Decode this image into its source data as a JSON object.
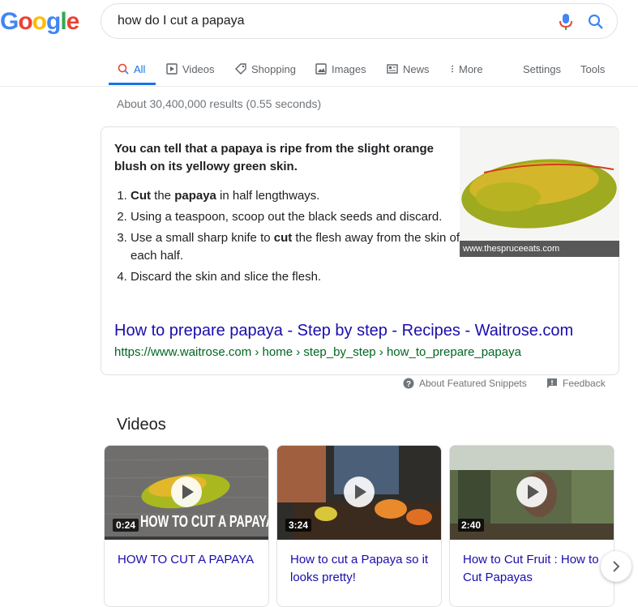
{
  "logo": [
    "G",
    "o",
    "o",
    "g",
    "l",
    "e"
  ],
  "logo_colors": [
    "#4285f4",
    "#ea4335",
    "#fbbc05",
    "#4285f4",
    "#34a853",
    "#ea4335"
  ],
  "search": {
    "query": "how do I cut a papaya"
  },
  "tabs": [
    {
      "label": "All",
      "icon": "search-icon"
    },
    {
      "label": "Videos",
      "icon": "play-box-icon"
    },
    {
      "label": "Shopping",
      "icon": "tag-icon"
    },
    {
      "label": "Images",
      "icon": "image-icon"
    },
    {
      "label": "News",
      "icon": "newspaper-icon"
    },
    {
      "label": "More",
      "icon": "dots-vertical-icon"
    },
    {
      "label": "Settings"
    },
    {
      "label": "Tools"
    }
  ],
  "results_stats": "About 30,400,000 results (0.55 seconds)",
  "snippet": {
    "answer": "You can tell that a papaya is ripe from the slight orange blush on its yellowy green skin.",
    "steps": [
      {
        "pre": "",
        "b1": "Cut",
        "mid": " the ",
        "b2": "papaya",
        "post": " in half lengthways."
      },
      {
        "pre": "Using a teaspoon, scoop out the black seeds and discard.",
        "b1": "",
        "mid": "",
        "b2": "",
        "post": ""
      },
      {
        "pre": "Use a small sharp knife to ",
        "b1": "cut",
        "mid": " the flesh away from the skin of each half.",
        "b2": "",
        "post": ""
      },
      {
        "pre": "Discard the skin and slice the flesh.",
        "b1": "",
        "mid": "",
        "b2": "",
        "post": ""
      }
    ],
    "image_caption": "www.thespruceeats.com",
    "title": "How to prepare papaya - Step by step - Recipes - Waitrose.com",
    "url": "https://www.waitrose.com › home › step_by_step › how_to_prepare_papaya"
  },
  "about_snippets": "About Featured Snippets",
  "feedback": "Feedback",
  "videos_heading": "Videos",
  "videos": [
    {
      "duration": "0:24",
      "overlay": "HOW TO CUT A PAPAYA",
      "title": "HOW TO CUT A PAPAYA"
    },
    {
      "duration": "3:24",
      "overlay": "",
      "title": "How to cut a Papaya so it looks pretty!"
    },
    {
      "duration": "2:40",
      "overlay": "",
      "title": "How to Cut Fruit : How to Cut Papayas"
    }
  ],
  "colors": {
    "link": "#1a0dab",
    "url_green": "#006621",
    "accent": "#1a73e8"
  }
}
